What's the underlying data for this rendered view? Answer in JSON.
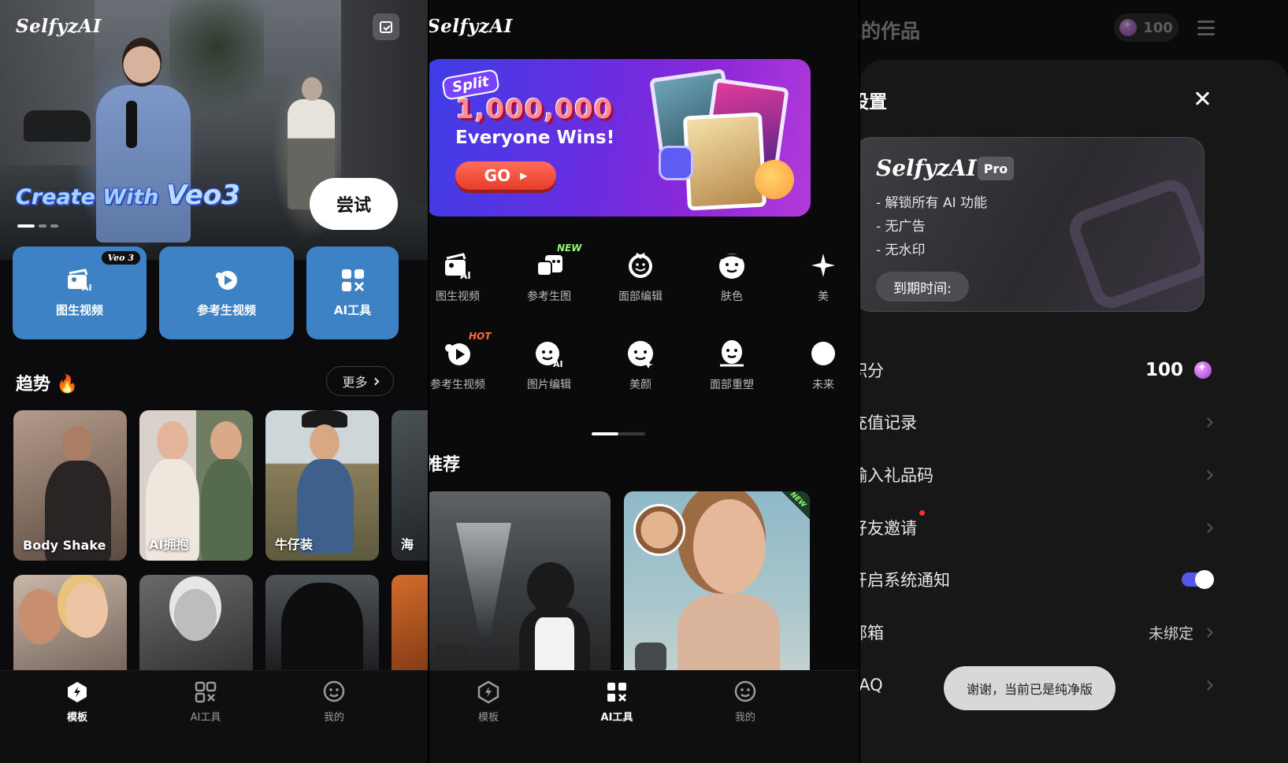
{
  "panel1": {
    "logo": "SelfyzAI",
    "hero": {
      "title_a": "Create With ",
      "title_b": "Veo3",
      "try_label": "尝试"
    },
    "features": [
      {
        "label": "图生视频",
        "badge": "Veo 3"
      },
      {
        "label": "参考生视频"
      },
      {
        "label": "AI工具"
      }
    ],
    "trend": {
      "title": "趋势",
      "more": "更多"
    },
    "cards": [
      {
        "label": "Body Shake"
      },
      {
        "label": "AI拥抱"
      },
      {
        "label": "牛仔装"
      },
      {
        "label": "海"
      }
    ],
    "tabs": [
      "模板",
      "AI工具",
      "我的"
    ],
    "colors": {
      "feature_bg": "#3d82c4",
      "tab_active": "#ffffff"
    }
  },
  "panel2": {
    "logo": "SelfyzAI",
    "banner": {
      "split": "Split",
      "amount": "1,000,000",
      "headline": "Everyone Wins!",
      "go": "GO"
    },
    "tools_row1": [
      {
        "label": "图生视频",
        "icon": "image-to-video-icon"
      },
      {
        "label": "参考生图",
        "icon": "reference-image-icon",
        "tag": "NEW"
      },
      {
        "label": "面部编辑",
        "icon": "face-edit-icon"
      },
      {
        "label": "肤色",
        "icon": "skin-tone-icon"
      },
      {
        "label": "美",
        "icon": "sparkle-icon"
      }
    ],
    "tools_row2": [
      {
        "label": "参考生视频",
        "icon": "reference-video-icon",
        "tag": "HOT"
      },
      {
        "label": "图片编辑",
        "icon": "photo-edit-icon"
      },
      {
        "label": "美颜",
        "icon": "beauty-icon"
      },
      {
        "label": "面部重塑",
        "icon": "face-reshape-icon"
      },
      {
        "label": "未来",
        "icon": "future-icon"
      }
    ],
    "recommend_title": "推荐",
    "new_tag": "NEW",
    "tabs": [
      "模板",
      "AI工具",
      "我的"
    ]
  },
  "panel3": {
    "bg_title": "我的作品",
    "bg_points": "100",
    "settings_title": "设置",
    "pro": {
      "logo": "SelfyzAI",
      "badge": "Pro",
      "perks": [
        "- 解锁所有 AI 功能",
        "- 无广告",
        "- 无水印"
      ],
      "expire_label": "到期时间:"
    },
    "rows": [
      {
        "label": "积分",
        "value": "100"
      },
      {
        "label": "充值记录"
      },
      {
        "label": "输入礼品码"
      },
      {
        "label": "好友邀请"
      },
      {
        "label": "开启系统通知",
        "toggle": true
      },
      {
        "label": "邮箱",
        "value": "未绑定"
      },
      {
        "label": "FAQ"
      }
    ],
    "toast": "谢谢，当前已是纯净版",
    "colors": {
      "toggle": "#5856e6",
      "points_gem": "#c05cf0"
    }
  }
}
